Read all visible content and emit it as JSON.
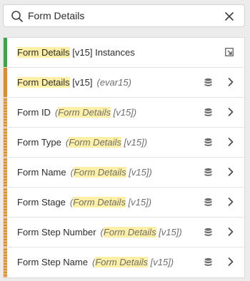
{
  "search": {
    "value": "Form Details",
    "placeholder": "Search"
  },
  "rows": [
    {
      "parts": [
        "Form Details",
        " [v15] Instances"
      ],
      "desc": [],
      "stripe": "#3aa64b",
      "stripe_style": "solid",
      "icon": "popout-icon"
    },
    {
      "parts": [
        "Form Details",
        " [v15]"
      ],
      "desc": [
        "(evar15)"
      ],
      "stripe": "#e08c2a",
      "stripe_style": "solid",
      "icon": "dataset-icon"
    },
    {
      "parts": [
        "Form ID"
      ],
      "desc": [
        "(",
        "Form Details",
        " [v15])"
      ],
      "stripe": "#e08c2a",
      "stripe_style": "dotted",
      "icon": "dataset-icon"
    },
    {
      "parts": [
        "Form Type"
      ],
      "desc": [
        "(",
        "Form Details",
        " [v15])"
      ],
      "stripe": "#e08c2a",
      "stripe_style": "dotted",
      "icon": "dataset-icon"
    },
    {
      "parts": [
        "Form Name"
      ],
      "desc": [
        "(",
        "Form Details",
        " [v15])"
      ],
      "stripe": "#e08c2a",
      "stripe_style": "dotted",
      "icon": "dataset-icon"
    },
    {
      "parts": [
        "Form Stage"
      ],
      "desc": [
        "(",
        "Form Details",
        " [v15])"
      ],
      "stripe": "#e08c2a",
      "stripe_style": "dotted",
      "icon": "dataset-icon"
    },
    {
      "parts": [
        "Form Step Number"
      ],
      "desc": [
        "(",
        "Form Details",
        " [v15])"
      ],
      "stripe": "#e08c2a",
      "stripe_style": "dotted",
      "icon": "dataset-icon"
    },
    {
      "parts": [
        "Form Step Name"
      ],
      "desc": [
        "(",
        "Form Details",
        " [v15])"
      ],
      "stripe": "#e08c2a",
      "stripe_style": "dotted",
      "icon": "dataset-icon"
    }
  ]
}
